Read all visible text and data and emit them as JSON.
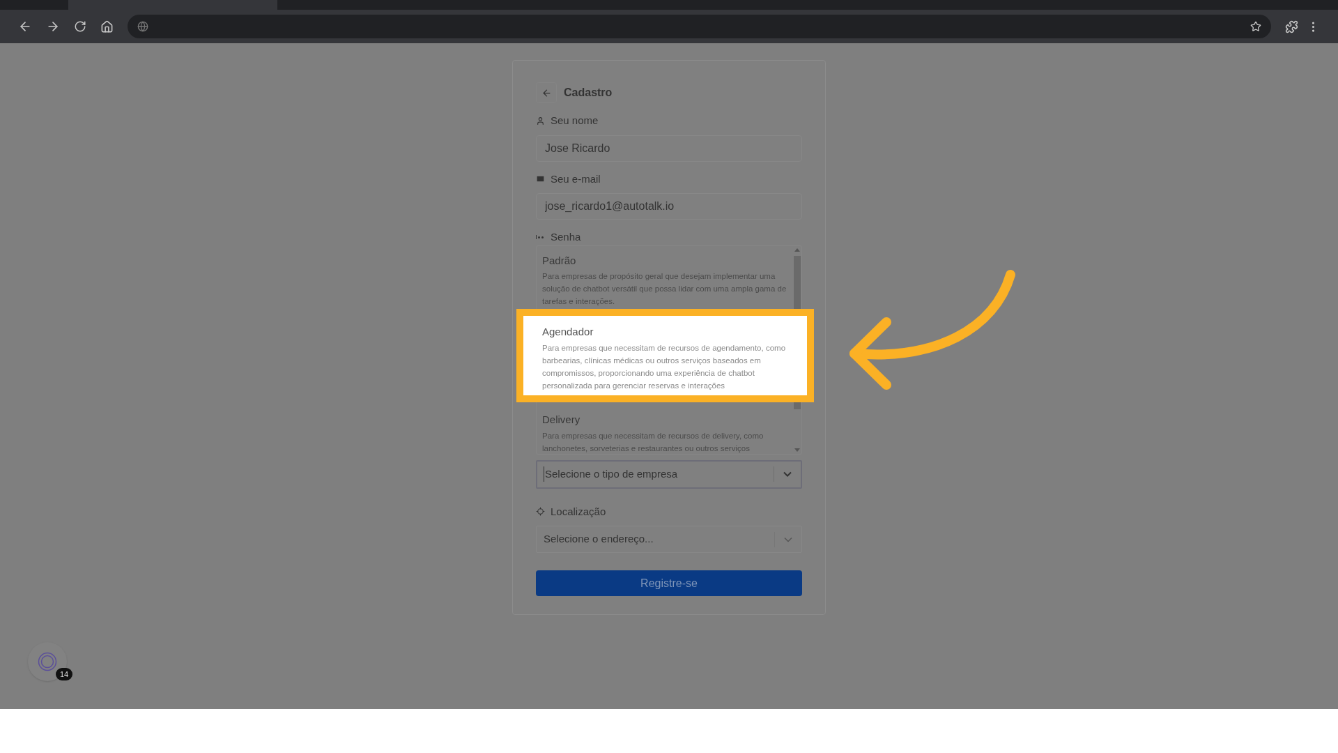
{
  "form": {
    "title": "Cadastro",
    "fields": [
      {
        "label": "Seu nome",
        "value": "Jose Ricardo"
      },
      {
        "label": "Seu e-mail",
        "value": "jose_ricardo1@autotalk.io"
      }
    ],
    "password": {
      "label": "Senha"
    },
    "company_type": {
      "options": [
        {
          "title": "Padrão",
          "description": "Para empresas de propósito geral que desejam implementar uma solução de chatbot versátil que possa lidar com uma ampla gama de tarefas e interações.",
          "highlighted": false
        },
        {
          "title": "Agendador",
          "description": "Para empresas que necessitam de recursos de agendamento, como barbearias, clínicas médicas ou outros serviços baseados em compromissos, proporcionando uma experiência de chatbot personalizada para gerenciar reservas e interações",
          "highlighted": true
        },
        {
          "title": "Delivery",
          "description": "Para empresas que necessitam de recursos de delivery, como lanchonetes, sorveterias e restaurantes ou outros serviços",
          "highlighted": false
        }
      ],
      "placeholder": "Selecione o tipo de empresa"
    },
    "location": {
      "label": "Localização",
      "placeholder": "Selecione o endereço..."
    },
    "submit": "Registre-se"
  },
  "assistant_badge": {
    "count": "14"
  }
}
